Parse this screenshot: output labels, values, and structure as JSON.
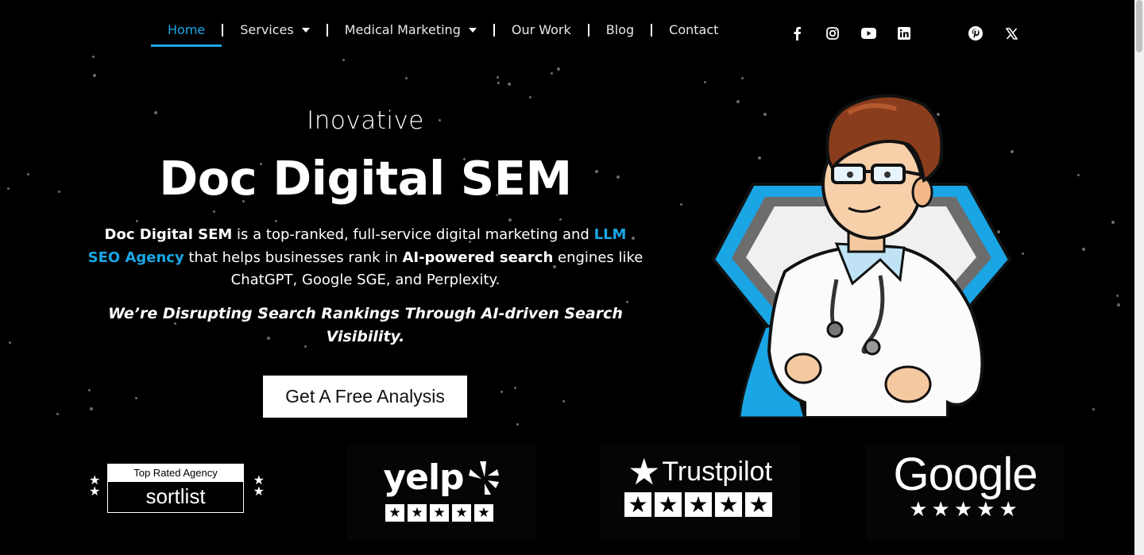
{
  "nav": {
    "items": [
      {
        "label": "Home",
        "active": true,
        "has_dropdown": false
      },
      {
        "label": "Services",
        "active": false,
        "has_dropdown": true
      },
      {
        "label": "Medical Marketing",
        "active": false,
        "has_dropdown": true
      },
      {
        "label": "Our Work",
        "active": false,
        "has_dropdown": false
      },
      {
        "label": "Blog",
        "active": false,
        "has_dropdown": false
      },
      {
        "label": "Contact",
        "active": false,
        "has_dropdown": false
      }
    ],
    "accent_color": "#19a7e6"
  },
  "socials": [
    "facebook-icon",
    "instagram-icon",
    "youtube-icon",
    "linkedin-icon",
    "pinterest-icon",
    "x-icon"
  ],
  "hero": {
    "kicker": "Inovative",
    "title": "Doc Digital SEM",
    "desc_brand": "Doc Digital SEM",
    "desc_part1": " is a top-ranked, full-service digital marketing and ",
    "desc_link": "LLM SEO Agency",
    "desc_part2": " that helps businesses rank in ",
    "desc_bold": "AI-powered search",
    "desc_part3": " engines like ChatGPT, Google SGE, and Perplexity.",
    "tagline": "We’re Disrupting Search Rankings Through AI-driven Search Visibility.",
    "cta_label": "Get A Free Analysis"
  },
  "logos": {
    "sortlist": {
      "top_label": "Top Rated Agency",
      "name": "sortlist"
    },
    "yelp": {
      "name": "yelp",
      "stars": 5
    },
    "trustpilot": {
      "name": "Trustpilot",
      "stars": 5
    },
    "google": {
      "name": "Google",
      "stars": 5
    }
  }
}
